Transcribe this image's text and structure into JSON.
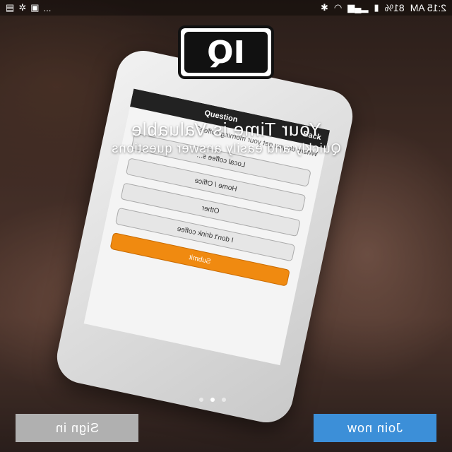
{
  "status_bar": {
    "time": "2:15 AM",
    "battery": "81%",
    "overflow": "..."
  },
  "logo": {
    "text": "IQ"
  },
  "hero": {
    "headline": "Your Time is Valuable",
    "subtitle": "Quickly and easily answer questions"
  },
  "phone_screen": {
    "back_label": "Back",
    "title": "Question",
    "question": "Where do you get your morning coffee?",
    "options": [
      "Local coffee s...",
      "Home / Office",
      "Other",
      "I don't drink coffee"
    ],
    "submit_label": "Submit"
  },
  "pager": {
    "count": 3,
    "active_index": 1
  },
  "buttons": {
    "sign_in": "Sign in",
    "join_now": "Join now"
  },
  "colors": {
    "join_button": "#3c8fd8",
    "sign_in_button": "#b0b0b0",
    "submit_button": "#f08a10"
  }
}
